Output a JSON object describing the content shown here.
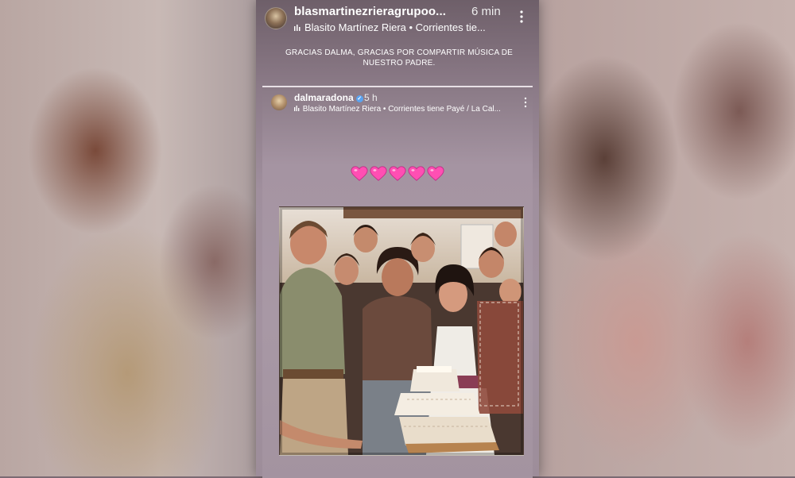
{
  "story": {
    "username": "blasmartinezrieragrupoo...",
    "time": "6 min",
    "music": "Blasito Martínez Riera • Corrientes tie...",
    "caption_line1": "GRACIAS DALMA, GRACIAS POR COMPARTIR MÚSICA DE",
    "caption_line2": "NUESTRO PADRE."
  },
  "reshare": {
    "username": "dalmaradona",
    "time": "5 h",
    "music": "Blasito Martínez Riera • Corrientes tiene Payé / La Cal...",
    "hearts_count": 5
  },
  "colors": {
    "heart": "#ff4fb3",
    "verified": "#5aa3f0"
  },
  "icons": [
    "music-bars-icon",
    "more-options-icon",
    "verified-icon",
    "heart-icon"
  ]
}
